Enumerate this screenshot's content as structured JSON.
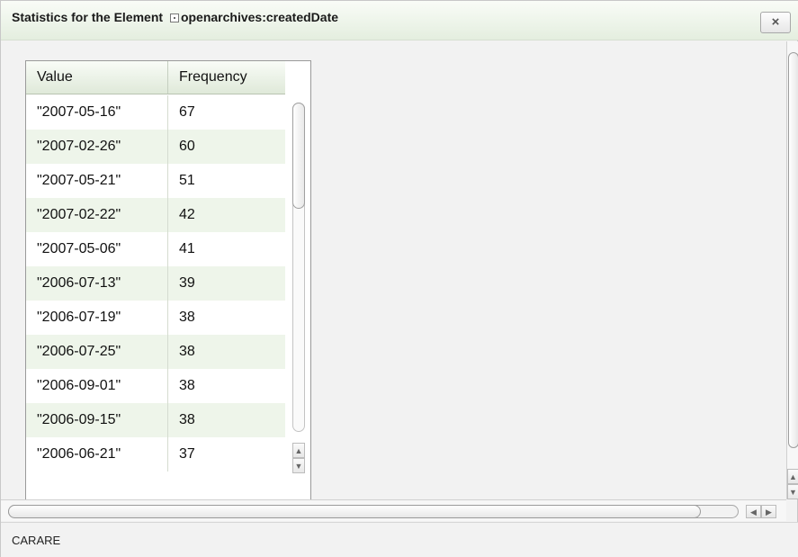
{
  "dialog": {
    "title_prefix": "Statistics for the Element",
    "element_name": "openarchives:createdDate",
    "close_label": "×"
  },
  "table": {
    "columns": [
      "Value",
      "Frequency"
    ],
    "rows": [
      {
        "value": "\"2007-05-16\"",
        "frequency": "67"
      },
      {
        "value": "\"2007-02-26\"",
        "frequency": "60"
      },
      {
        "value": "\"2007-05-21\"",
        "frequency": "51"
      },
      {
        "value": "\"2007-02-22\"",
        "frequency": "42"
      },
      {
        "value": "\"2007-05-06\"",
        "frequency": "41"
      },
      {
        "value": "\"2006-07-13\"",
        "frequency": "39"
      },
      {
        "value": "\"2006-07-19\"",
        "frequency": "38"
      },
      {
        "value": "\"2006-07-25\"",
        "frequency": "38"
      },
      {
        "value": "\"2006-09-01\"",
        "frequency": "38"
      },
      {
        "value": "\"2006-09-15\"",
        "frequency": "38"
      },
      {
        "value": "\"2006-06-21\"",
        "frequency": "37"
      }
    ]
  },
  "footer": {
    "label": "CARARE"
  }
}
